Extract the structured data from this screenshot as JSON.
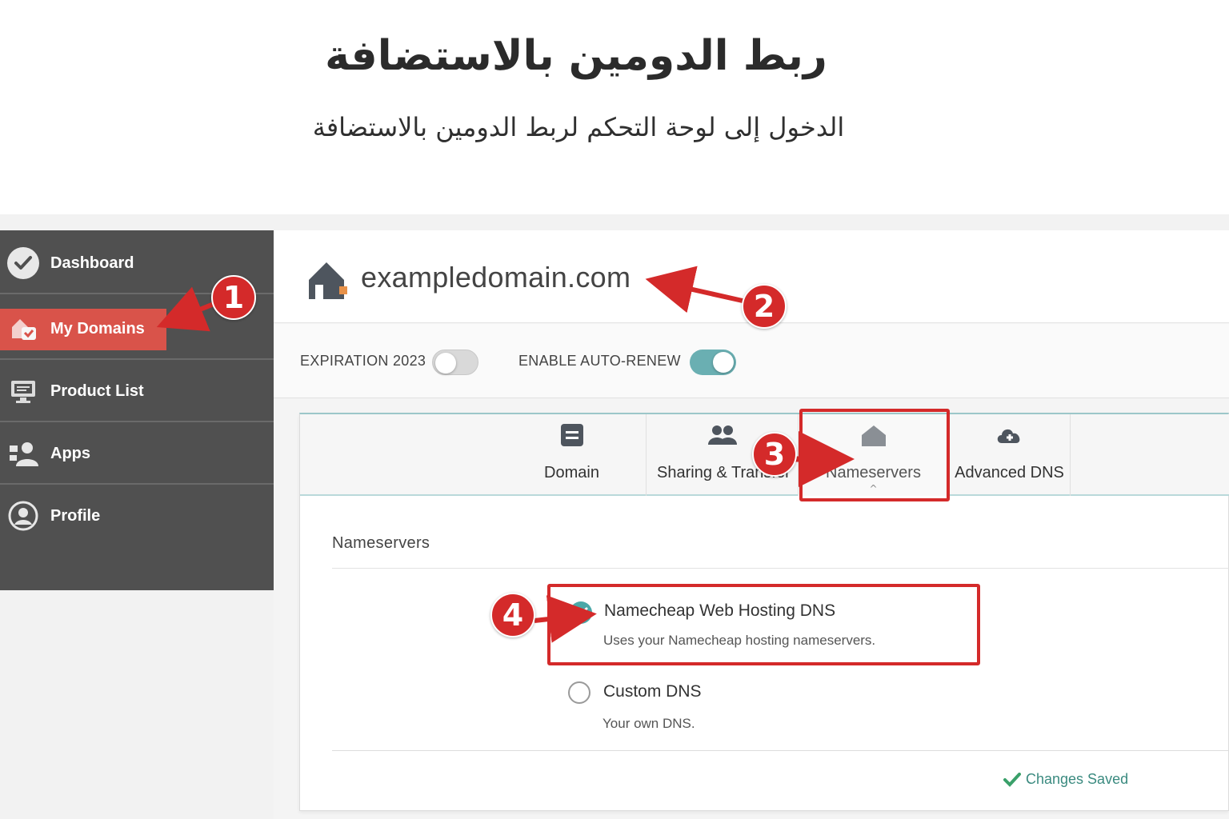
{
  "header": {
    "title": "ربط الدومين بالاستضافة",
    "subtitle": "الدخول إلى لوحة التحكم لربط الدومين بالاستضافة"
  },
  "sidebar": {
    "items": [
      {
        "label": "Dashboard",
        "icon": "check-circle-icon"
      },
      {
        "label": "My Domains",
        "icon": "domains-home-icon",
        "active": true
      },
      {
        "label": "Product List",
        "icon": "monitor-icon"
      },
      {
        "label": "Apps",
        "icon": "users-apps-icon"
      },
      {
        "label": "Profile",
        "icon": "user-circle-icon"
      }
    ],
    "active_color": "#d9534a",
    "background": "#505050"
  },
  "domain": {
    "name": "exampledomain.com",
    "icon": "house-icon"
  },
  "options": {
    "expiration_label": "EXPIRATION  2023",
    "expiration_toggle_on": false,
    "auto_renew_label": "ENABLE AUTO-RENEW",
    "auto_renew_toggle_on": true,
    "toggle_on_color": "#6aafb2"
  },
  "tabs": [
    {
      "label": "Domain",
      "icon": "document-icon"
    },
    {
      "label": "Sharing & Transfer",
      "icon": "group-icon"
    },
    {
      "label": "Nameservers",
      "icon": "home-icon",
      "active": true
    },
    {
      "label": "Advanced DNS",
      "icon": "cloud-icon"
    }
  ],
  "nameservers": {
    "heading": "Nameservers",
    "options": [
      {
        "title": "Namecheap Web Hosting DNS",
        "description": "Uses your Namecheap hosting nameservers.",
        "selected": true
      },
      {
        "title": "Custom DNS",
        "description": "Your own DNS.",
        "selected": false
      }
    ],
    "status": "Changes Saved"
  },
  "annotations": {
    "steps": [
      "1",
      "2",
      "3",
      "4"
    ],
    "color": "#d42a2a"
  }
}
